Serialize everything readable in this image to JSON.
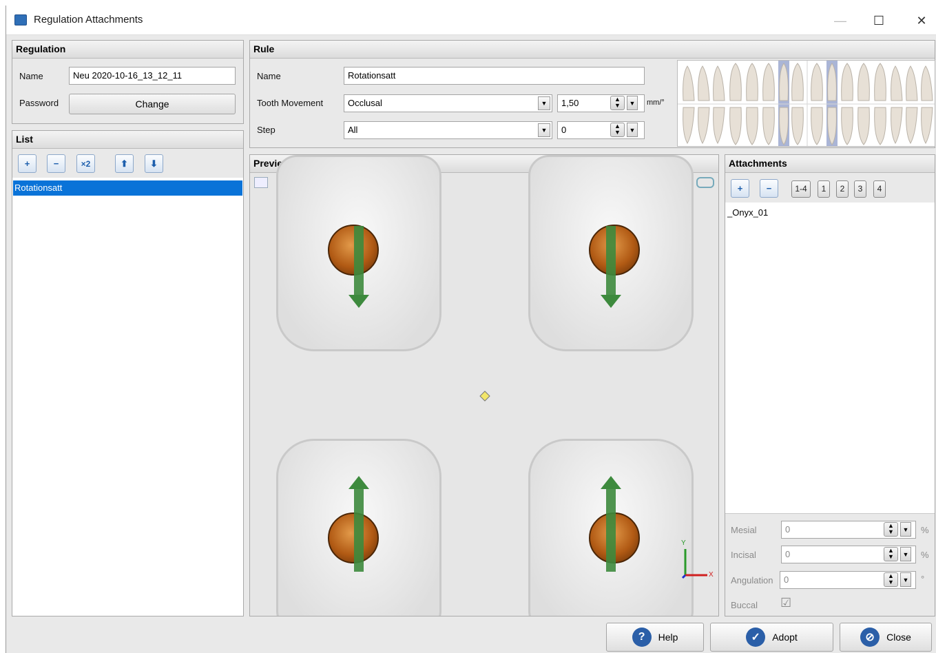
{
  "window": {
    "title": "Regulation Attachments",
    "minimize": "—",
    "maximize": "☐",
    "close": "✕"
  },
  "regulation": {
    "header": "Regulation",
    "name_label": "Name",
    "name_value": "Neu 2020-10-16_13_12_11",
    "password_label": "Password",
    "change_button": "Change"
  },
  "list": {
    "header": "List",
    "add": "+",
    "remove": "−",
    "duplicate": "×2",
    "up": "⬆",
    "down": "⬇",
    "items": [
      "Rotationsatt"
    ]
  },
  "rule": {
    "header": "Rule",
    "name_label": "Name",
    "name_value": "Rotationsatt",
    "movement_label": "Tooth Movement",
    "movement_value": "Occlusal",
    "movement_amount": "1,50",
    "movement_unit": "mm/°",
    "step_label": "Step",
    "step_value": "All",
    "step_amount": "0"
  },
  "preview": {
    "header": "Preview",
    "axis_y": "Y",
    "axis_x": "X"
  },
  "attachments": {
    "header": "Attachments",
    "add": "+",
    "remove": "−",
    "range_buttons": [
      "1-4",
      "1",
      "2",
      "3",
      "4"
    ],
    "items": [
      "_Onyx_01"
    ],
    "mesial_label": "Mesial",
    "mesial_value": "0",
    "mesial_unit": "%",
    "incisal_label": "Incisal",
    "incisal_value": "0",
    "incisal_unit": "%",
    "angulation_label": "Angulation",
    "angulation_value": "0",
    "angulation_unit": "°",
    "buccal_label": "Buccal",
    "buccal_check": "☑"
  },
  "footer": {
    "help": "Help",
    "adopt": "Adopt",
    "close": "Close"
  },
  "colors": {
    "selection": "#0a73d8",
    "arrow": "#3d8a3d",
    "attachment": "#b15a14"
  }
}
